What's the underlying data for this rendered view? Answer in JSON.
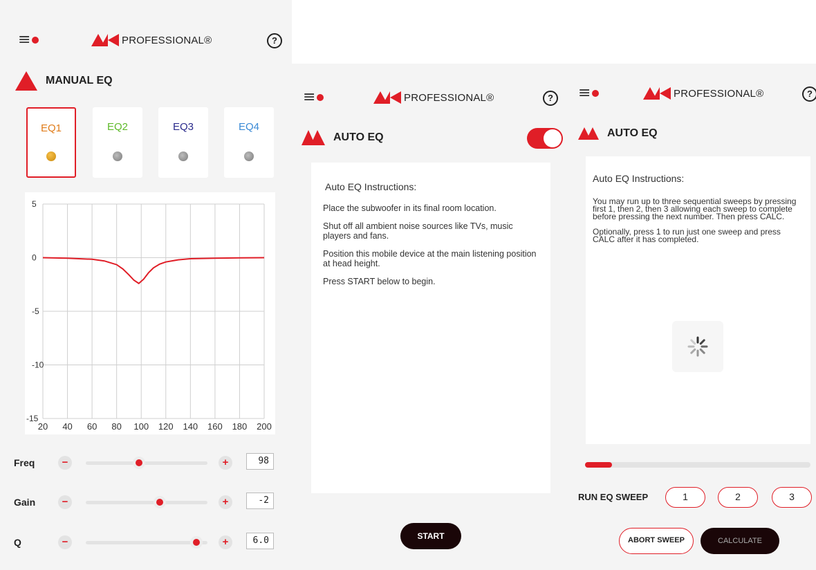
{
  "brand": {
    "mark": "MK",
    "text": "PROFESSIONAL®",
    "accent": "#e01e27",
    "dark": "#1a0608"
  },
  "manual": {
    "title": "MANUAL EQ",
    "tabs": [
      {
        "label": "EQ1",
        "color": "#e07c1a",
        "active": true
      },
      {
        "label": "EQ2",
        "color": "#5fba2a",
        "active": false
      },
      {
        "label": "EQ3",
        "color": "#2a2a8c",
        "active": false
      },
      {
        "label": "EQ4",
        "color": "#3a8ad6",
        "active": false
      }
    ],
    "sliders": [
      {
        "name": "Freq",
        "value": "98",
        "position": 0.44
      },
      {
        "name": "Gain",
        "value": "-2",
        "position": 0.61
      },
      {
        "name": "Q",
        "value": "6.0",
        "position": 0.91
      }
    ],
    "chart_data": {
      "type": "line",
      "xlim": [
        20,
        200
      ],
      "ylim": [
        -15,
        5
      ],
      "x_ticks": [
        "20",
        "40",
        "60",
        "80",
        "100",
        "120",
        "140",
        "160",
        "180",
        "200"
      ],
      "y_ticks": [
        "5",
        "0",
        "-5",
        "-10",
        "-15"
      ],
      "series": [
        {
          "color": "#e01e27",
          "x": [
            20,
            40,
            60,
            70,
            80,
            85,
            90,
            94,
            98,
            102,
            106,
            110,
            115,
            120,
            130,
            140,
            160,
            180,
            200
          ],
          "y": [
            0,
            -0.05,
            -0.15,
            -0.3,
            -0.65,
            -1.05,
            -1.6,
            -2.1,
            -2.4,
            -2.0,
            -1.4,
            -0.95,
            -0.6,
            -0.4,
            -0.2,
            -0.1,
            -0.05,
            -0.02,
            0
          ]
        }
      ],
      "grid": true
    }
  },
  "auto1": {
    "title": "AUTO EQ",
    "toggle_on": true,
    "instructions_title": "Auto EQ Instructions:",
    "instructions": [
      "Place the subwoofer in its final room location.",
      "Shut off all ambient noise sources like TVs, music players and fans.",
      "Position this mobile device at the main listening position at head height.",
      "Press START below to begin."
    ],
    "start_label": "START"
  },
  "auto2": {
    "title": "AUTO EQ",
    "instructions_title": "Auto EQ Instructions:",
    "instructions": [
      "You may run up to three sequential sweeps by pressing first 1, then 2, then 3 allowing each sweep to complete before pressing the next number. Then press CALC.",
      "Optionally, press 1 to run just one sweep and press CALC after it has completed."
    ],
    "progress": 0.12,
    "run_label": "RUN EQ SWEEP",
    "sweeps": [
      "1",
      "2",
      "3"
    ],
    "abort_label": "ABORT SWEEP",
    "calculate_label": "CALCULATE"
  }
}
